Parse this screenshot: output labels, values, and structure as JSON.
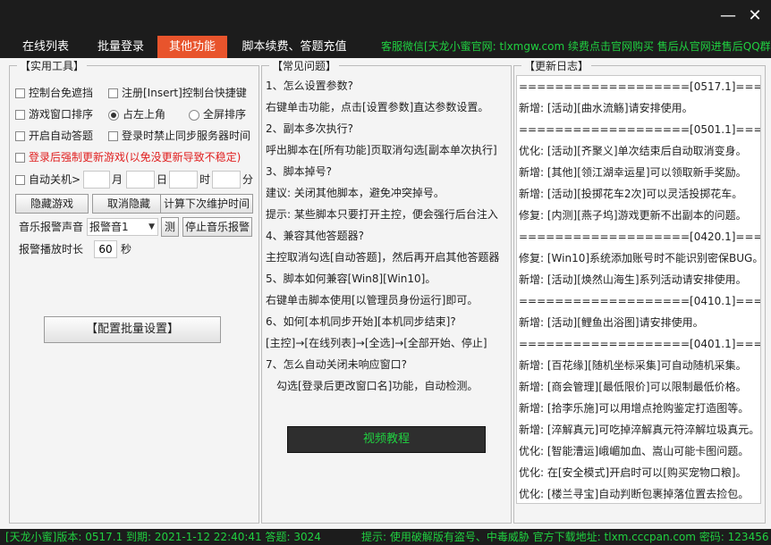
{
  "window": {
    "minimize_label": "—",
    "close_label": "✕"
  },
  "tabs": [
    {
      "label": "在线列表",
      "active": false
    },
    {
      "label": "批量登录",
      "active": false
    },
    {
      "label": "其他功能",
      "active": true
    },
    {
      "label": "脚本续费、答题充值",
      "active": false
    }
  ],
  "top_notice": "客服微信[天龙小蜜官网: tlxmgw.com 续费点击官网购买 售后从官网进售后QQ群]",
  "tools": {
    "title": "【实用工具】",
    "checkboxes": {
      "console_no_mask": "控制台免遮挡",
      "register_hotkey": "注册[Insert]控制台快捷键",
      "game_window_sort": "游戏窗口排序",
      "auto_answer": "开启自动答题",
      "disable_sync_server_time": "登录时禁止同步服务器时间",
      "force_update_after_login": "登录后强制更新游戏(以免没更新导致不稳定)",
      "auto_shutdown": "自动关机>"
    },
    "radios": {
      "top_left": "占左上角",
      "fullscreen": "全屏排序"
    },
    "shutdown": {
      "month_value": "",
      "month_label": "月",
      "day_value": "",
      "day_label": "日",
      "hour_value": "",
      "hour_label": "时",
      "minute_value": "",
      "minute_label": "分"
    },
    "buttons": {
      "hide_game": "隐藏游戏",
      "cancel_hide": "取消隐藏",
      "calc_maintenance": "计算下次维护时间",
      "test": "测",
      "stop_music": "停止音乐报警",
      "batch_config": "【配置批量设置】"
    },
    "music_alarm_label": "音乐报警声音",
    "music_alarm_value": "报警音1",
    "alarm_duration_label": "报警播放时长",
    "alarm_duration_value": "60",
    "alarm_duration_unit": "秒"
  },
  "faq": {
    "title": "【常见问题】",
    "lines": [
      "1、怎么设置参数?",
      "右键单击功能，点击[设置参数]直达参数设置。",
      "2、副本多次执行?",
      "呼出脚本在[所有功能]页取消勾选[副本单次执行]",
      "3、脚本掉号?",
      "建议: 关闭其他脚本，避免冲突掉号。",
      "提示: 某些脚本只要打开主控，便会强行后台注入",
      "4、兼容其他答题器?",
      "主控取消勾选[自动答题]，然后再开启其他答题器",
      "5、脚本如何兼容[Win8][Win10]。",
      "右键单击脚本使用[以管理员身份运行]即可。",
      "6、如何[本机同步开始][本机同步结束]?",
      "[主控]→[在线列表]→[全选]→[全部开始、停止]",
      "7、怎么自动关闭未响应窗口?",
      "　勾选[登录后更改窗口名]功能，自动检测。"
    ],
    "video_button": "视频教程"
  },
  "changelog": {
    "title": "【更新日志】",
    "lines": [
      "===================[0517.1]==================",
      "新增: [活动][曲水流觞]请安排使用。",
      "===================[0501.1]==================",
      "优化: [活动][齐聚义]单次结束后自动取消变身。",
      "新增: [其他][领江湖幸运星]可以领取新手奖励。",
      "新增: [活动][投掷花车2次]可以灵活投掷花车。",
      "修复: [内测][燕子坞]游戏更新不出副本的问题。",
      "===================[0420.1]==================",
      "修复: [Win10]系统添加账号时不能识别密保BUG。",
      "新增: [活动][焕然山海生]系列活动请安排使用。",
      "===================[0410.1]==================",
      "新增: [活动][鲤鱼出浴图]请安排使用。",
      "===================[0401.1]==================",
      "新增: [百花缘][随机坐标采集]可自动随机采集。",
      "新增: [商会管理][最低限价]可以限制最低价格。",
      "新增: [拾李乐施]可以用增点抢购鉴定打造图等。",
      "新增: [淬解真元]可吃掉淬解真元符淬解垃圾真元。",
      "优化: [智能漕运]峨嵋加血、嵩山可能卡图问题。",
      "优化: 在[安全模式]开启时可以[购买宠物口粮]。",
      "优化: [楼兰寻宝]自动判断包裹掉落位置去捡包。"
    ]
  },
  "statusbar": {
    "left": "[天龙小蜜]版本: 0517.1   到期: 2021-1-12 22:40:41   答题: 3024",
    "right": "提示: 使用破解版有盗号、中毒威胁 官方下载地址: tlxm.cccpan.com 密码: 123456"
  }
}
